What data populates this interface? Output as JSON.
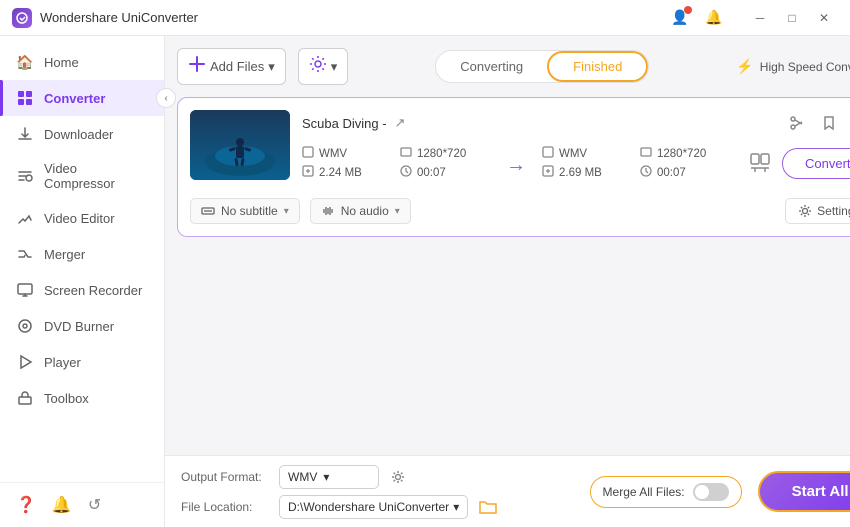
{
  "app": {
    "title": "Wondershare UniConverter",
    "icon_text": "W"
  },
  "title_bar": {
    "controls": [
      "minimize",
      "maximize",
      "close"
    ]
  },
  "sidebar": {
    "items": [
      {
        "id": "home",
        "label": "Home",
        "icon": "🏠"
      },
      {
        "id": "converter",
        "label": "Converter",
        "icon": "⬛",
        "active": true
      },
      {
        "id": "downloader",
        "label": "Downloader",
        "icon": "⬇"
      },
      {
        "id": "video-compressor",
        "label": "Video Compressor",
        "icon": "🔀"
      },
      {
        "id": "video-editor",
        "label": "Video Editor",
        "icon": "✂"
      },
      {
        "id": "merger",
        "label": "Merger",
        "icon": "🔗"
      },
      {
        "id": "screen-recorder",
        "label": "Screen Recorder",
        "icon": "📹"
      },
      {
        "id": "dvd-burner",
        "label": "DVD Burner",
        "icon": "💿"
      },
      {
        "id": "player",
        "label": "Player",
        "icon": "▶"
      },
      {
        "id": "toolbox",
        "label": "Toolbox",
        "icon": "🔧"
      }
    ],
    "bottom_icons": [
      "❓",
      "🔔",
      "↺"
    ]
  },
  "toolbar": {
    "add_files_label": "Add Files",
    "add_files_icon": "📄",
    "add_dropdown_icon": "▾",
    "settings_icon": "⚙",
    "settings_dropdown_icon": "▾"
  },
  "tabs": {
    "converting_label": "Converting",
    "finished_label": "Finished",
    "active_tab": "Finished"
  },
  "speed": {
    "label": "High Speed Conversion",
    "icon": "⚡"
  },
  "video_card": {
    "title": "Scuba Diving -",
    "external_icon": "↗",
    "source": {
      "format": "WMV",
      "resolution": "1280*720",
      "size": "2.24 MB",
      "duration": "00:07"
    },
    "target": {
      "format": "WMV",
      "resolution": "1280*720",
      "size": "2.69 MB",
      "duration": "00:07"
    },
    "arrow": "→",
    "toolbar_icons": [
      "✂",
      "🔖",
      "☰"
    ],
    "subtitle_label": "No subtitle",
    "audio_label": "No audio",
    "settings_label": "Settings",
    "convert_btn_label": "Convert"
  },
  "bottom_bar": {
    "output_format_label": "Output Format:",
    "output_format_value": "WMV",
    "file_location_label": "File Location:",
    "file_location_value": "D:\\Wondershare UniConverter",
    "merge_label": "Merge All Files:",
    "merge_on": false,
    "start_all_label": "Start All"
  }
}
